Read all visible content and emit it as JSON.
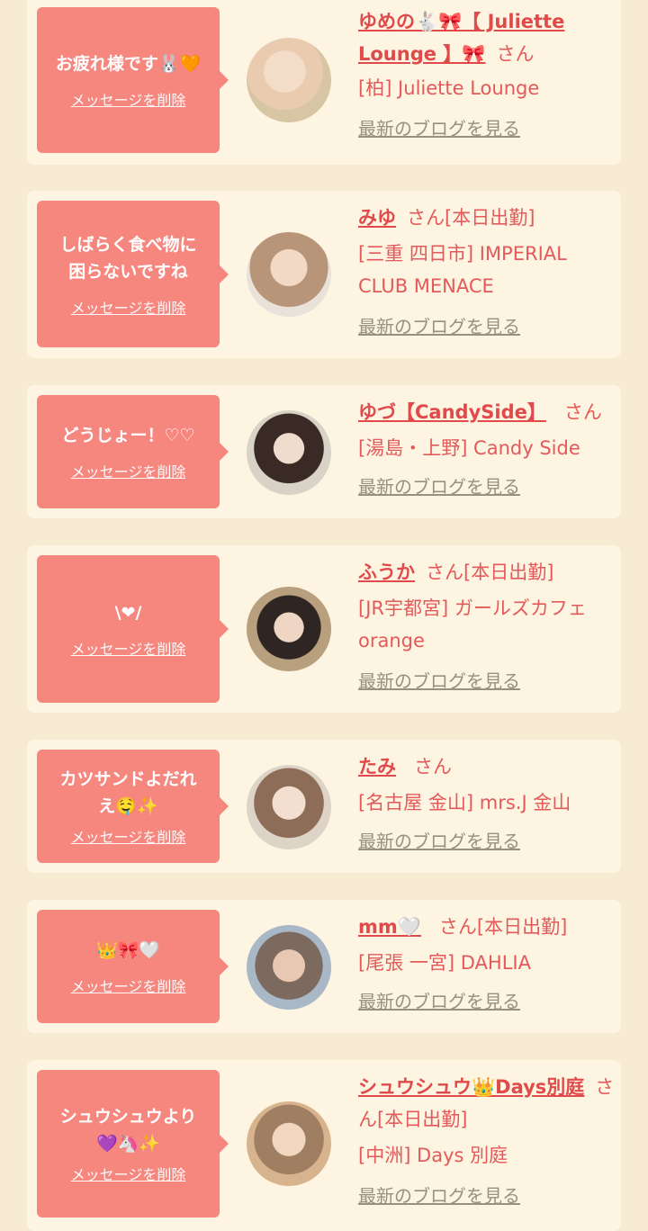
{
  "delete_label": "メッセージを削除",
  "blog_label": "最新のブログを見る",
  "san_label": "さん",
  "cards": [
    {
      "message": "お疲れ様です🐰🧡",
      "name": "ゆめの🐇🎀【 Juliette Lounge 】🎀",
      "status": "",
      "shop": "[柏] Juliette Lounge"
    },
    {
      "message": "しばらく食べ物に\n困らないですね",
      "name": "みゆ",
      "status": "[本日出勤]",
      "shop": "[三重 四日市] IMPERIAL CLUB MENACE"
    },
    {
      "message": "どうじょー！♡♡",
      "name": "ゆづ【CandySide】",
      "status": "",
      "shop": "[湯島・上野] Candy Side"
    },
    {
      "message": "\\❤/",
      "name": "ふうか",
      "status": "[本日出勤]",
      "shop": "[JR宇都宮] ガールズカフェ orange"
    },
    {
      "message": "カツサンドよだれ\nえ🤤✨",
      "name": "たみ",
      "status": "",
      "shop": "[名古屋 金山] mrs.J 金山"
    },
    {
      "message": "👑🎀🤍",
      "name": "mm🤍",
      "status": "[本日出勤]",
      "shop": "[尾張 一宮] DAHLIA"
    },
    {
      "message": "シュウシュウより\n💜🦄✨",
      "name": "シュウシュウ👑Days別庭",
      "status": "[本日出勤]",
      "shop": "[中洲] Days 別庭"
    }
  ]
}
